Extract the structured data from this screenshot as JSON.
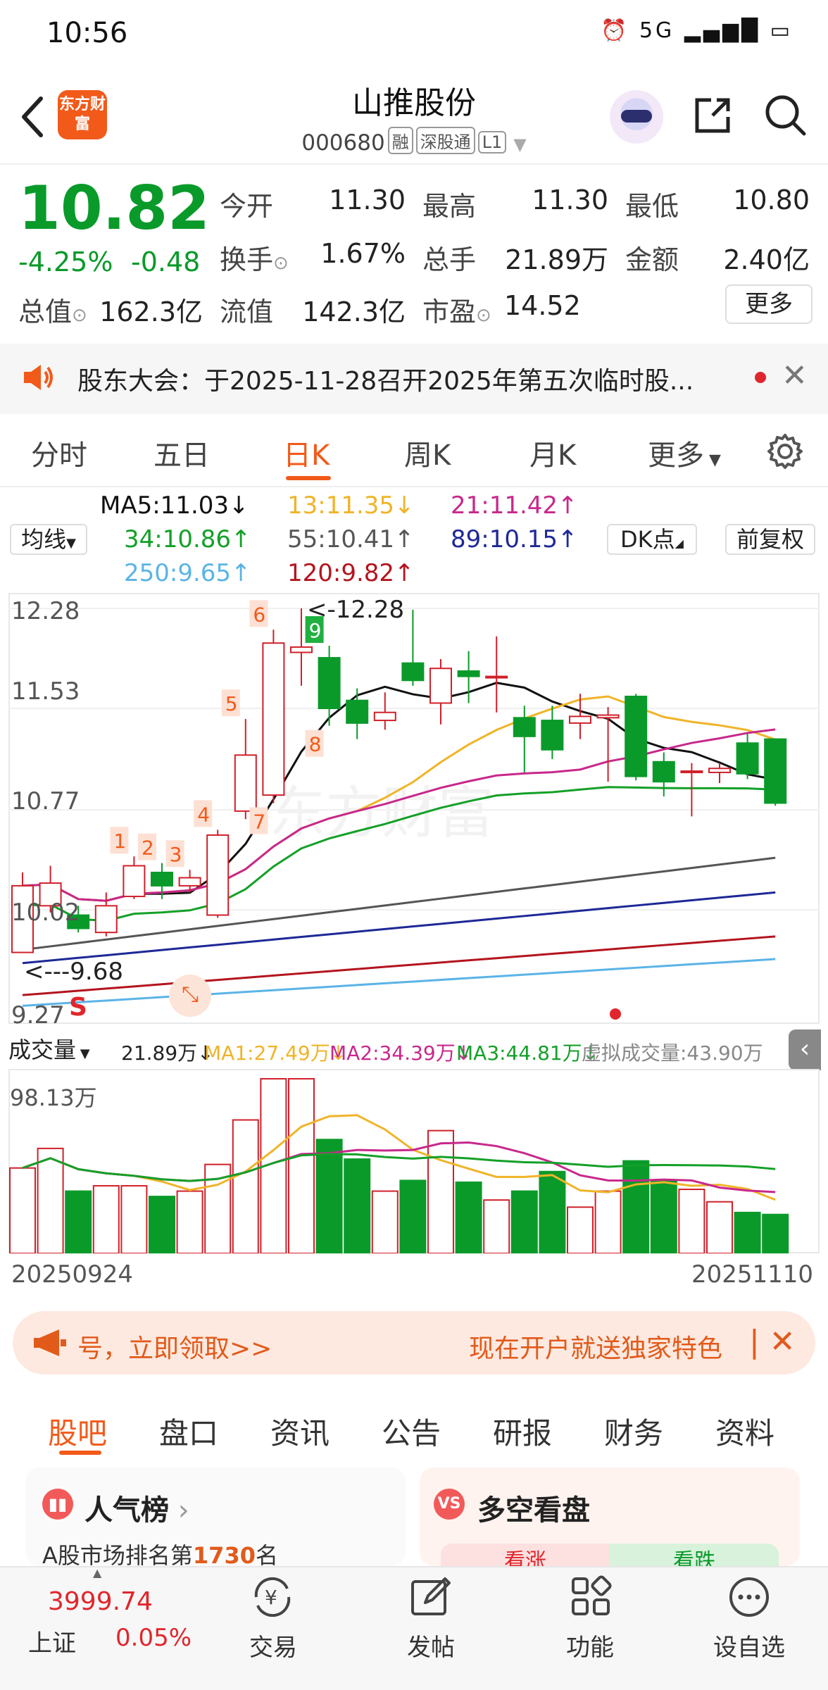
{
  "status_bar": {
    "time": "10:56",
    "icons": "⏰ 5G ▂▄▆█ ▭"
  },
  "header": {
    "logo_text": "东方财富",
    "title": "山推股份",
    "code": "000680",
    "tags": [
      "融",
      "深股通",
      "L1"
    ]
  },
  "quote": {
    "price": "10.82",
    "change_pct": "-4.25%",
    "change_abs": "-0.48",
    "fields": [
      {
        "label": "今开",
        "value": "11.30"
      },
      {
        "label": "最高",
        "value": "11.30"
      },
      {
        "label": "最低",
        "value": "10.80"
      },
      {
        "label": "换手",
        "value": "1.67%"
      },
      {
        "label": "总手",
        "value": "21.89万"
      },
      {
        "label": "金额",
        "value": "2.40亿"
      },
      {
        "label": "总值",
        "value": "162.3亿"
      },
      {
        "label": "流值",
        "value": "142.3亿"
      },
      {
        "label": "市盈",
        "value": "14.52"
      }
    ],
    "more_label": "更多"
  },
  "notice": {
    "text": "股东大会：于2025-11-28召开2025年第五次临时股..."
  },
  "ktabs": [
    "分时",
    "五日",
    "日K",
    "周K",
    "月K",
    "更多"
  ],
  "ma_legend": {
    "selector": "均线",
    "ma5": "MA5:11.03↓",
    "ma13": "13:11.35↓",
    "ma21": "21:11.42↑",
    "ma34": "34:10.86↑",
    "ma55": "55:10.41↑",
    "ma89": "89:10.15↑",
    "ma250": "250:9.65↑",
    "ma120": "120:9.82↑",
    "dk_label": "DK点",
    "fq_label": "前复权",
    "colors": {
      "ma5": "#111111",
      "ma13": "#f0b428",
      "ma21": "#c8288c",
      "ma34": "#14a028",
      "ma55": "#555555",
      "ma89": "#1e2896",
      "ma250": "#5ab4e6",
      "ma120": "#b4141e"
    }
  },
  "chart_axis": {
    "y_labels": [
      "12.28",
      "11.53",
      "10.77",
      "10.02",
      "9.27"
    ],
    "max_marker": "<-12.28",
    "min_marker": "<---9.68",
    "start_date": "20250924",
    "end_date": "20251110",
    "vol_max": "98.13万",
    "watermark": "东方财富",
    "signal_s": "S",
    "count_labels": [
      "1",
      "2",
      "3",
      "4",
      "5",
      "6",
      "7",
      "8",
      "9"
    ]
  },
  "volume_legend": {
    "selector": "成交量",
    "vol": "21.89万↓",
    "ma1": "MA1:27.49万↓",
    "ma2": "MA2:34.39万↓",
    "ma3": "MA3:44.81万↓",
    "virtual": "虚拟成交量:43.90万"
  },
  "chart_data": {
    "type": "candlestick",
    "x_start": "20250924",
    "x_end": "20251110",
    "ylim": [
      9.27,
      12.28
    ],
    "candles": [
      {
        "o": 9.7,
        "c": 10.2,
        "h": 10.3,
        "l": 9.7
      },
      {
        "o": 10.05,
        "c": 10.22,
        "h": 10.35,
        "l": 10.0
      },
      {
        "o": 9.98,
        "c": 9.88,
        "h": 10.05,
        "l": 9.85
      },
      {
        "o": 9.85,
        "c": 10.05,
        "h": 10.15,
        "l": 9.82
      },
      {
        "o": 10.12,
        "c": 10.35,
        "h": 10.42,
        "l": 10.1
      },
      {
        "o": 10.3,
        "c": 10.2,
        "h": 10.37,
        "l": 10.1
      },
      {
        "o": 10.2,
        "c": 10.26,
        "h": 10.32,
        "l": 10.15
      },
      {
        "o": 9.98,
        "c": 10.58,
        "h": 10.62,
        "l": 9.96
      },
      {
        "o": 10.76,
        "c": 11.18,
        "h": 11.45,
        "l": 10.7
      },
      {
        "o": 10.88,
        "c": 12.02,
        "h": 12.12,
        "l": 10.82
      },
      {
        "o": 11.95,
        "c": 11.99,
        "h": 12.28,
        "l": 11.7
      },
      {
        "o": 11.91,
        "c": 11.53,
        "h": 12.0,
        "l": 11.4
      },
      {
        "o": 11.59,
        "c": 11.42,
        "h": 11.68,
        "l": 11.3
      },
      {
        "o": 11.44,
        "c": 11.5,
        "h": 11.65,
        "l": 11.37
      },
      {
        "o": 11.87,
        "c": 11.74,
        "h": 12.27,
        "l": 11.7
      },
      {
        "o": 11.57,
        "c": 11.83,
        "h": 11.9,
        "l": 11.41
      },
      {
        "o": 11.81,
        "c": 11.77,
        "h": 11.96,
        "l": 11.57
      },
      {
        "o": 11.77,
        "c": 11.77,
        "h": 12.07,
        "l": 11.5
      },
      {
        "o": 11.46,
        "c": 11.32,
        "h": 11.55,
        "l": 11.05
      },
      {
        "o": 11.44,
        "c": 11.22,
        "h": 11.55,
        "l": 11.15
      },
      {
        "o": 11.42,
        "c": 11.47,
        "h": 11.64,
        "l": 11.3
      },
      {
        "o": 11.46,
        "c": 11.48,
        "h": 11.54,
        "l": 10.98
      },
      {
        "o": 11.62,
        "c": 11.02,
        "h": 11.64,
        "l": 10.99
      },
      {
        "o": 11.13,
        "c": 10.98,
        "h": 11.2,
        "l": 10.87
      },
      {
        "o": 11.05,
        "c": 11.06,
        "h": 11.12,
        "l": 10.72
      },
      {
        "o": 11.05,
        "c": 11.08,
        "h": 11.12,
        "l": 10.97
      },
      {
        "o": 11.27,
        "c": 11.04,
        "h": 11.34,
        "l": 11.0
      },
      {
        "o": 11.3,
        "c": 10.82,
        "h": 11.3,
        "l": 10.8
      }
    ],
    "volumes": [
      48,
      59,
      35,
      38,
      38,
      32,
      35,
      50,
      75,
      98.13,
      98.13,
      64,
      53,
      35,
      41,
      69,
      40,
      30,
      35,
      46,
      26,
      35,
      52,
      41,
      36,
      29,
      23,
      21.89
    ]
  },
  "promo": {
    "left": "号，立即领取>>",
    "right": "现在开户就送独家特色"
  },
  "bottom_tabs": [
    "股吧",
    "盘口",
    "资讯",
    "公告",
    "研报",
    "财务",
    "资料"
  ],
  "cards": {
    "hot_title": "人气榜",
    "hot_sub_prefix": "A股市场排名第",
    "hot_rank": "1730",
    "hot_sub_suffix": "名",
    "ls_title": "多空看盘",
    "ls_up": "看涨",
    "ls_down": "看跌"
  },
  "bottom_nav": {
    "index_value": "3999.74",
    "index_name": "上证",
    "index_change": "0.05%",
    "items": [
      "交易",
      "发帖",
      "功能",
      "设自选"
    ]
  }
}
